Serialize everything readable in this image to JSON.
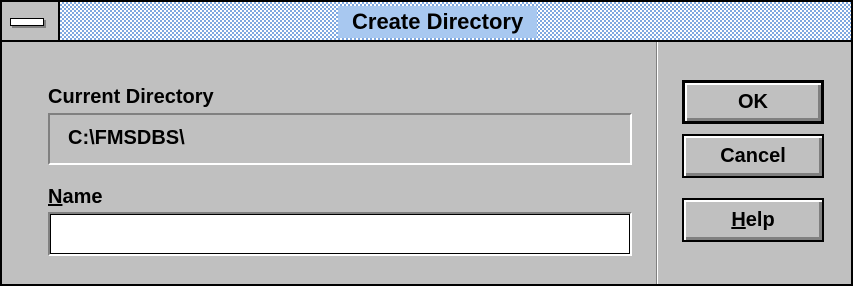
{
  "window": {
    "title": "Create Directory"
  },
  "current_directory": {
    "label": "Current Directory",
    "value": "C:\\FMSDBS\\"
  },
  "name_field": {
    "label_accel": "N",
    "label_rest": "ame",
    "value": ""
  },
  "buttons": {
    "ok": "OK",
    "cancel": "Cancel",
    "help_accel": "H",
    "help_rest": "elp"
  },
  "icons": {
    "system_menu": "system-menu-icon"
  }
}
